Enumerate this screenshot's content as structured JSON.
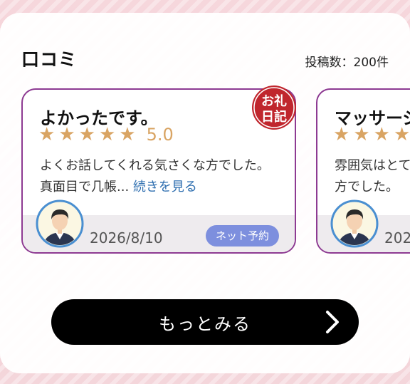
{
  "section": {
    "title": "口コミ",
    "post_count": "投稿数：200件"
  },
  "reviews": [
    {
      "title": "よかったです。",
      "rating": 5.0,
      "rating_text": "5.0",
      "text": "よくお話してくれる気さくな方でした。 真面目で几帳...",
      "read_more": "続きを見る",
      "date": "2026/8/10",
      "badge": "ネット予約",
      "stamp": "お礼日記"
    },
    {
      "title": "マッサージ",
      "text": "雰囲気はとて 方でした。",
      "date": "202"
    }
  ],
  "more_button": {
    "label": "もっとみる",
    "icon": "chevron-right-icon"
  },
  "colors": {
    "card_border": "#8d3a92",
    "star": "#d9a463",
    "badge": "#7d8fde",
    "link": "#2f6fb0",
    "stamp": "#c0262d"
  }
}
